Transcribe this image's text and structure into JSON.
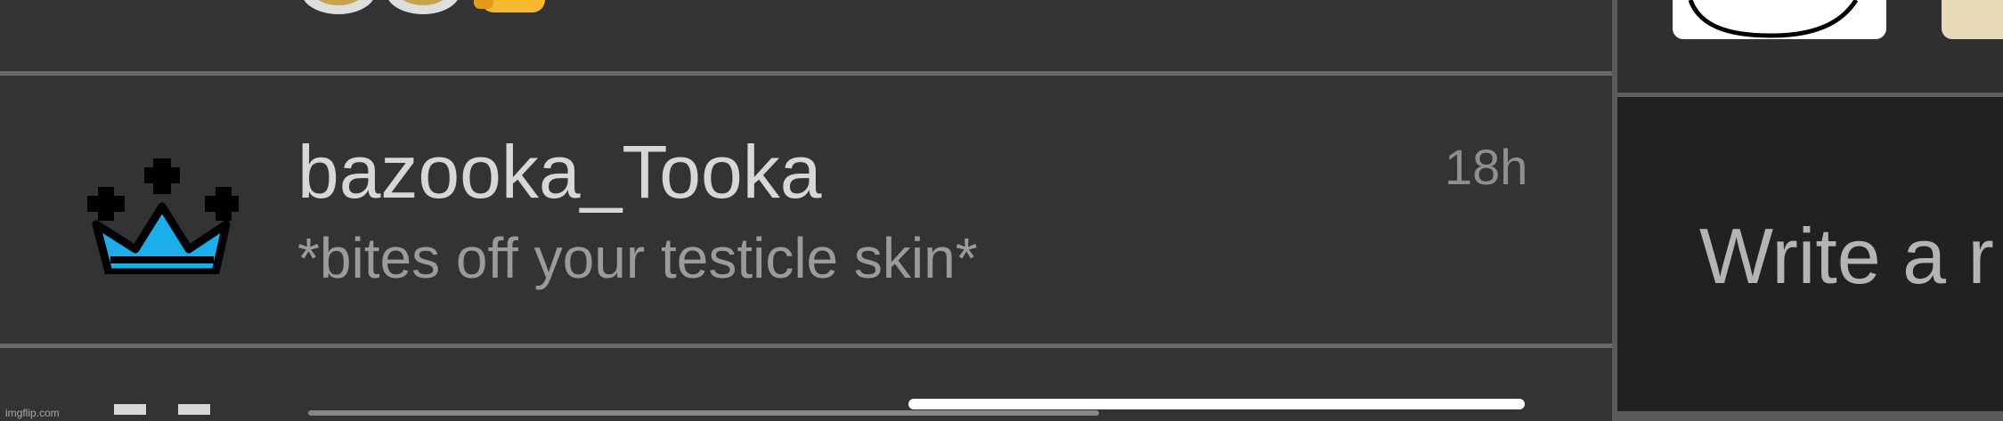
{
  "comment": {
    "username": "bazooka_Tooka",
    "text": "*bites off your testicle skin*",
    "timestamp": "18h"
  },
  "compose": {
    "placeholder": "Write a r"
  },
  "watermark": "imgflip.com",
  "icons": {
    "previous_row": "star-icon",
    "previous_emojis": "eyes-and-thumbs-up-emoji",
    "author_badge": "crown-icon"
  },
  "colors": {
    "background": "#333333",
    "divider": "#6a6a6a",
    "crown_fill": "#1aaeea",
    "username_text": "#d7d7d7",
    "comment_text": "#9b9b9b",
    "timestamp_text": "#8f8f8f",
    "compose_background": "#212121",
    "placeholder_text": "#b4b4b4"
  }
}
